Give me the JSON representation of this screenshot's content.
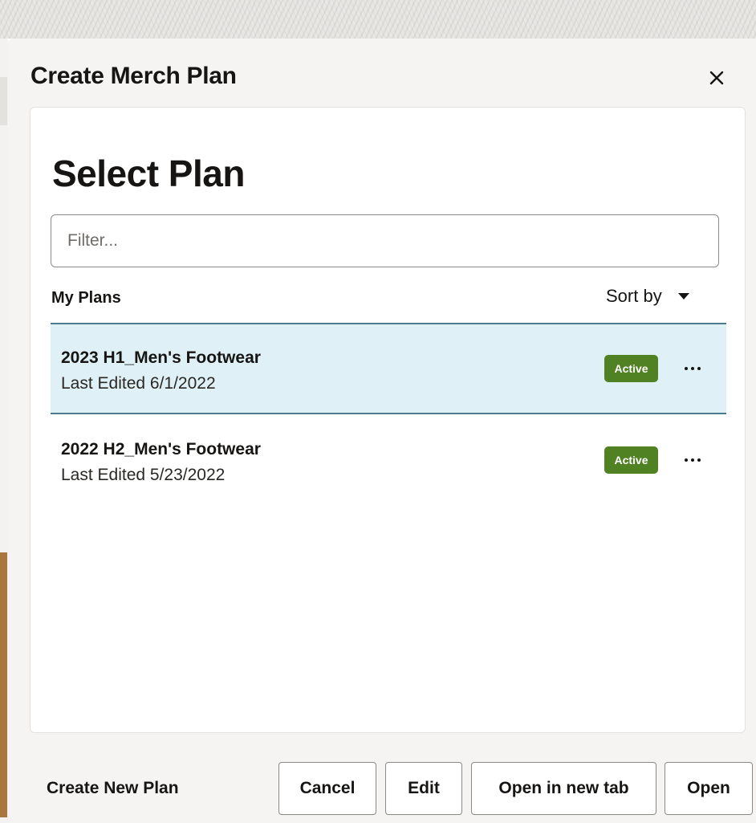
{
  "dialog": {
    "title": "Create Merch Plan",
    "close_icon": "close-icon"
  },
  "panel": {
    "heading": "Select Plan",
    "filter": {
      "placeholder": "Filter...",
      "value": ""
    },
    "section_label": "My Plans",
    "sort_label": "Sort by",
    "sort_icon": "caret-down-icon"
  },
  "plans": [
    {
      "name": "2023 H1_Men's Footwear",
      "edited": "Last Edited 6/1/2022",
      "status": "Active",
      "selected": true
    },
    {
      "name": "2022 H2_Men's Footwear",
      "edited": "Last Edited 5/23/2022",
      "status": "Active",
      "selected": false
    }
  ],
  "footer": {
    "create_new": "Create New Plan",
    "cancel": "Cancel",
    "edit": "Edit",
    "open_new_tab": "Open in new tab",
    "open": "Open"
  },
  "colors": {
    "selected_row": "#dff0f6",
    "status_active": "#508223",
    "dialog_bg": "#f5f4f2"
  }
}
